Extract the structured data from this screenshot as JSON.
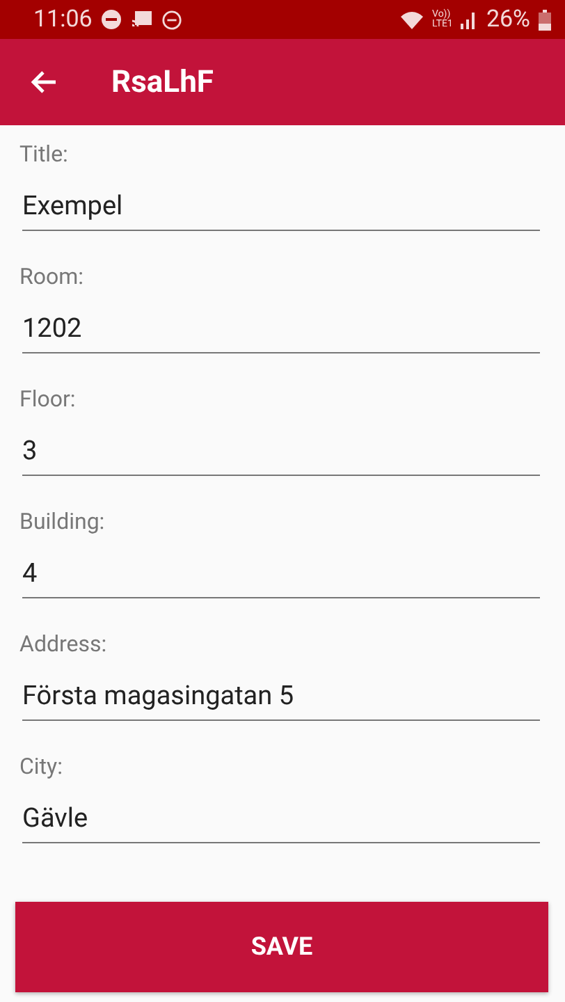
{
  "status_bar": {
    "time": "11:06",
    "volte_top": "Vo))",
    "volte_bottom": "LTE1",
    "battery": "26%"
  },
  "app_bar": {
    "title": "RsaLhF"
  },
  "fields": [
    {
      "label": "Title:",
      "value": "Exempel"
    },
    {
      "label": "Room:",
      "value": "1202"
    },
    {
      "label": "Floor:",
      "value": "3"
    },
    {
      "label": "Building:",
      "value": "4"
    },
    {
      "label": "Address:",
      "value": "Första magasingatan 5"
    },
    {
      "label": "City:",
      "value": "Gävle"
    }
  ],
  "buttons": [
    "SAVE"
  ]
}
